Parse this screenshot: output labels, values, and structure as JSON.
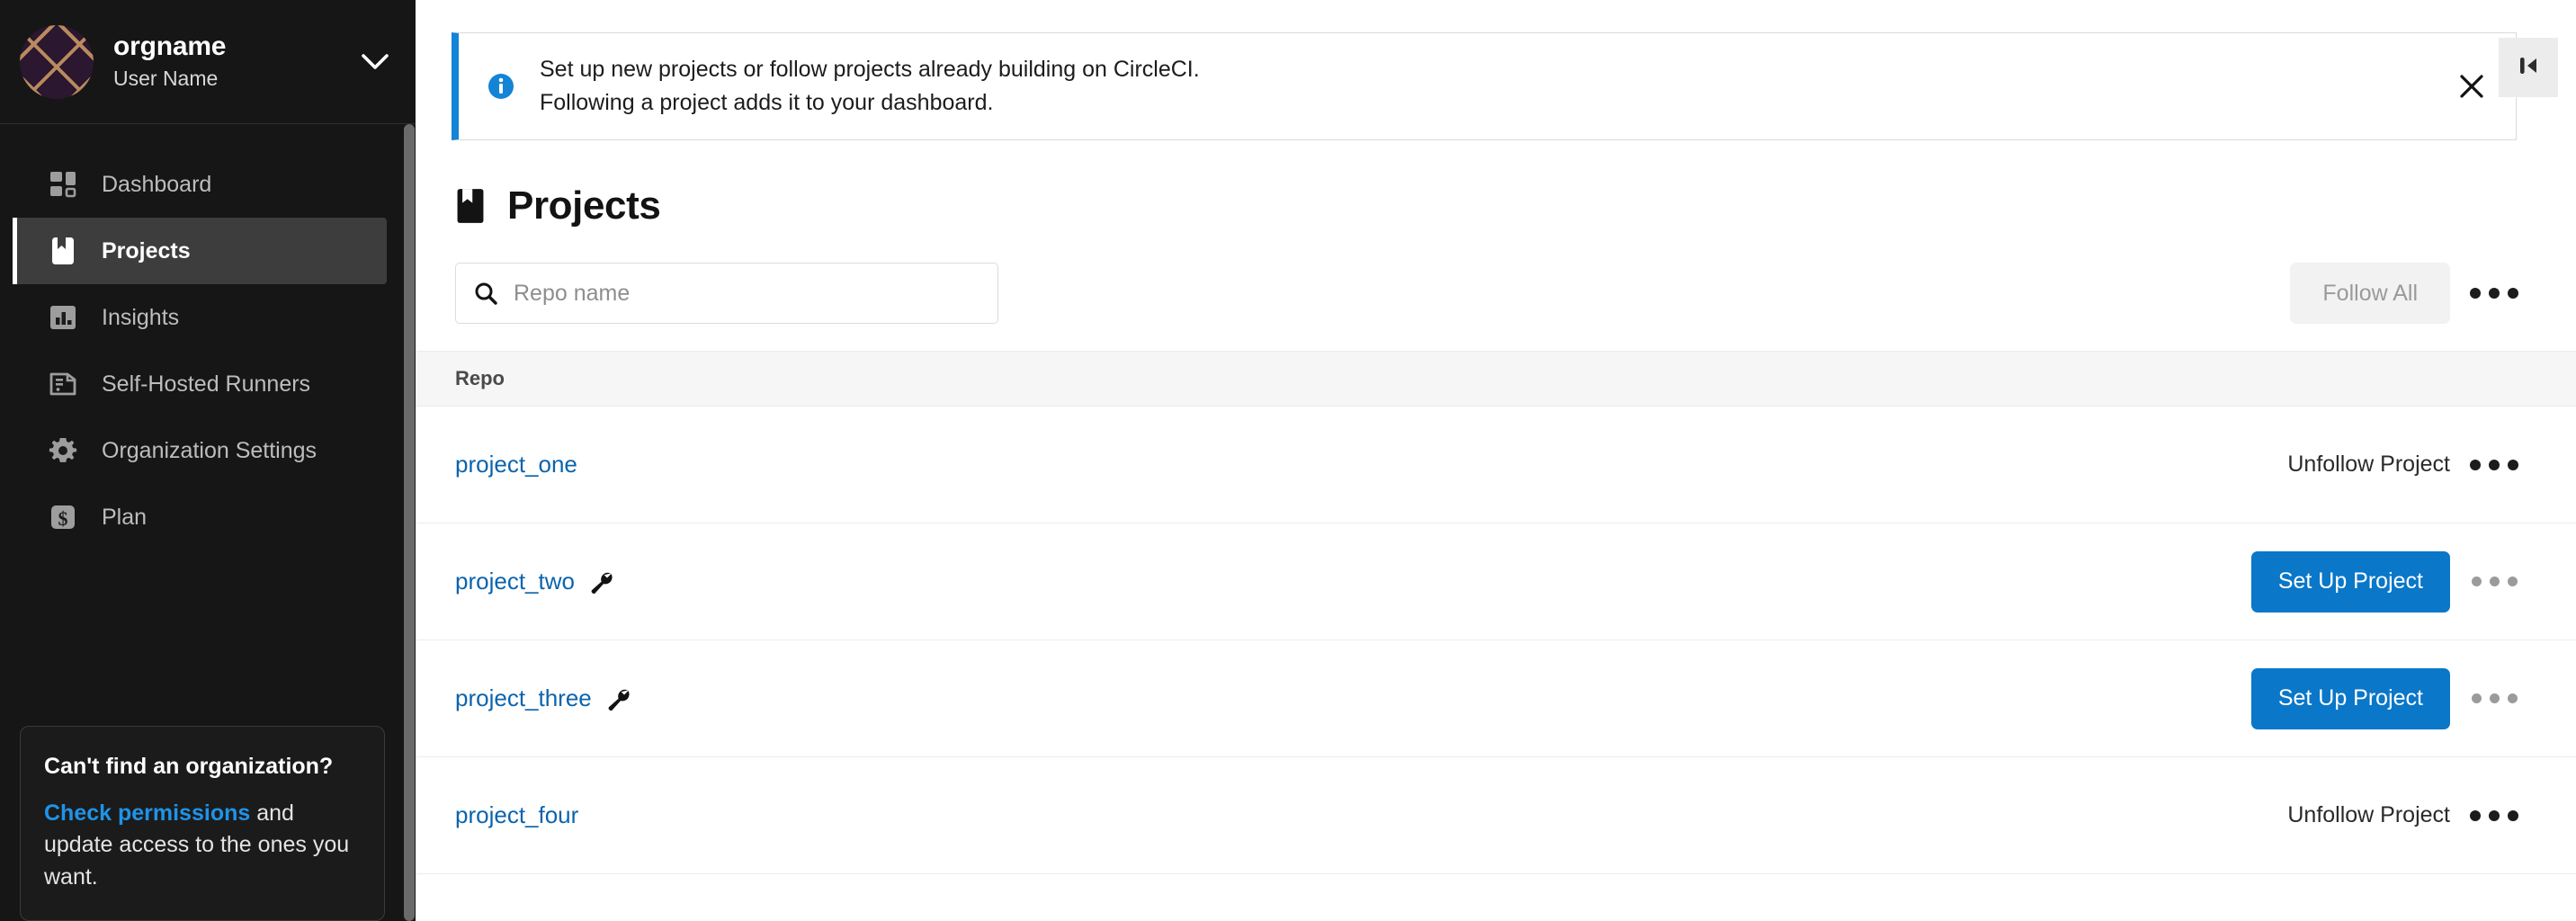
{
  "sidebar": {
    "org": {
      "name": "orgname",
      "user": "User Name",
      "avatar_icon": "org-avatar-lattice",
      "chevron_icon": "chevron-down-icon"
    },
    "items": [
      {
        "label": "Dashboard",
        "icon": "dashboard-grid-icon",
        "active": false
      },
      {
        "label": "Projects",
        "icon": "book-bookmark-icon",
        "active": true
      },
      {
        "label": "Insights",
        "icon": "bar-chart-icon",
        "active": false
      },
      {
        "label": "Self-Hosted Runners",
        "icon": "server-icon",
        "active": false
      },
      {
        "label": "Organization Settings",
        "icon": "gear-icon",
        "active": false
      },
      {
        "label": "Plan",
        "icon": "dollar-square-icon",
        "active": false
      }
    ],
    "help_card": {
      "title": "Can't find an organization?",
      "link": "Check permissions",
      "body_after_link": " and update access to the ones you want."
    }
  },
  "banner": {
    "icon": "info-circle-icon",
    "line1": "Set up new projects or follow projects already building on CircleCI.",
    "line2": "Following a project adds it to your dashboard.",
    "close_icon": "close-icon",
    "accent_color": "#1484d6"
  },
  "page": {
    "title": "Projects",
    "title_icon": "book-bookmark-icon"
  },
  "toolbar": {
    "search_placeholder": "Repo name",
    "search_value": "",
    "search_icon": "search-icon",
    "follow_all_label": "Follow All",
    "overflow_icon": "ellipsis-icon"
  },
  "table": {
    "columns": [
      "Repo"
    ],
    "rows": [
      {
        "name": "project_one",
        "has_wrench": false,
        "action_type": "text",
        "action_label": "Unfollow Project"
      },
      {
        "name": "project_two",
        "has_wrench": true,
        "action_type": "button",
        "action_label": "Set Up Project"
      },
      {
        "name": "project_three",
        "has_wrench": true,
        "action_type": "button",
        "action_label": "Set Up Project"
      },
      {
        "name": "project_four",
        "has_wrench": false,
        "action_type": "text",
        "action_label": "Unfollow Project"
      }
    ]
  },
  "collapse_panel": {
    "icon": "collapse-left-icon"
  },
  "colors": {
    "sidebar_bg": "#161616",
    "sidebar_active_bg": "#3d3d3d",
    "link_blue": "#0b64ad",
    "primary_blue": "#0a77c8",
    "banner_accent": "#1484d6"
  }
}
